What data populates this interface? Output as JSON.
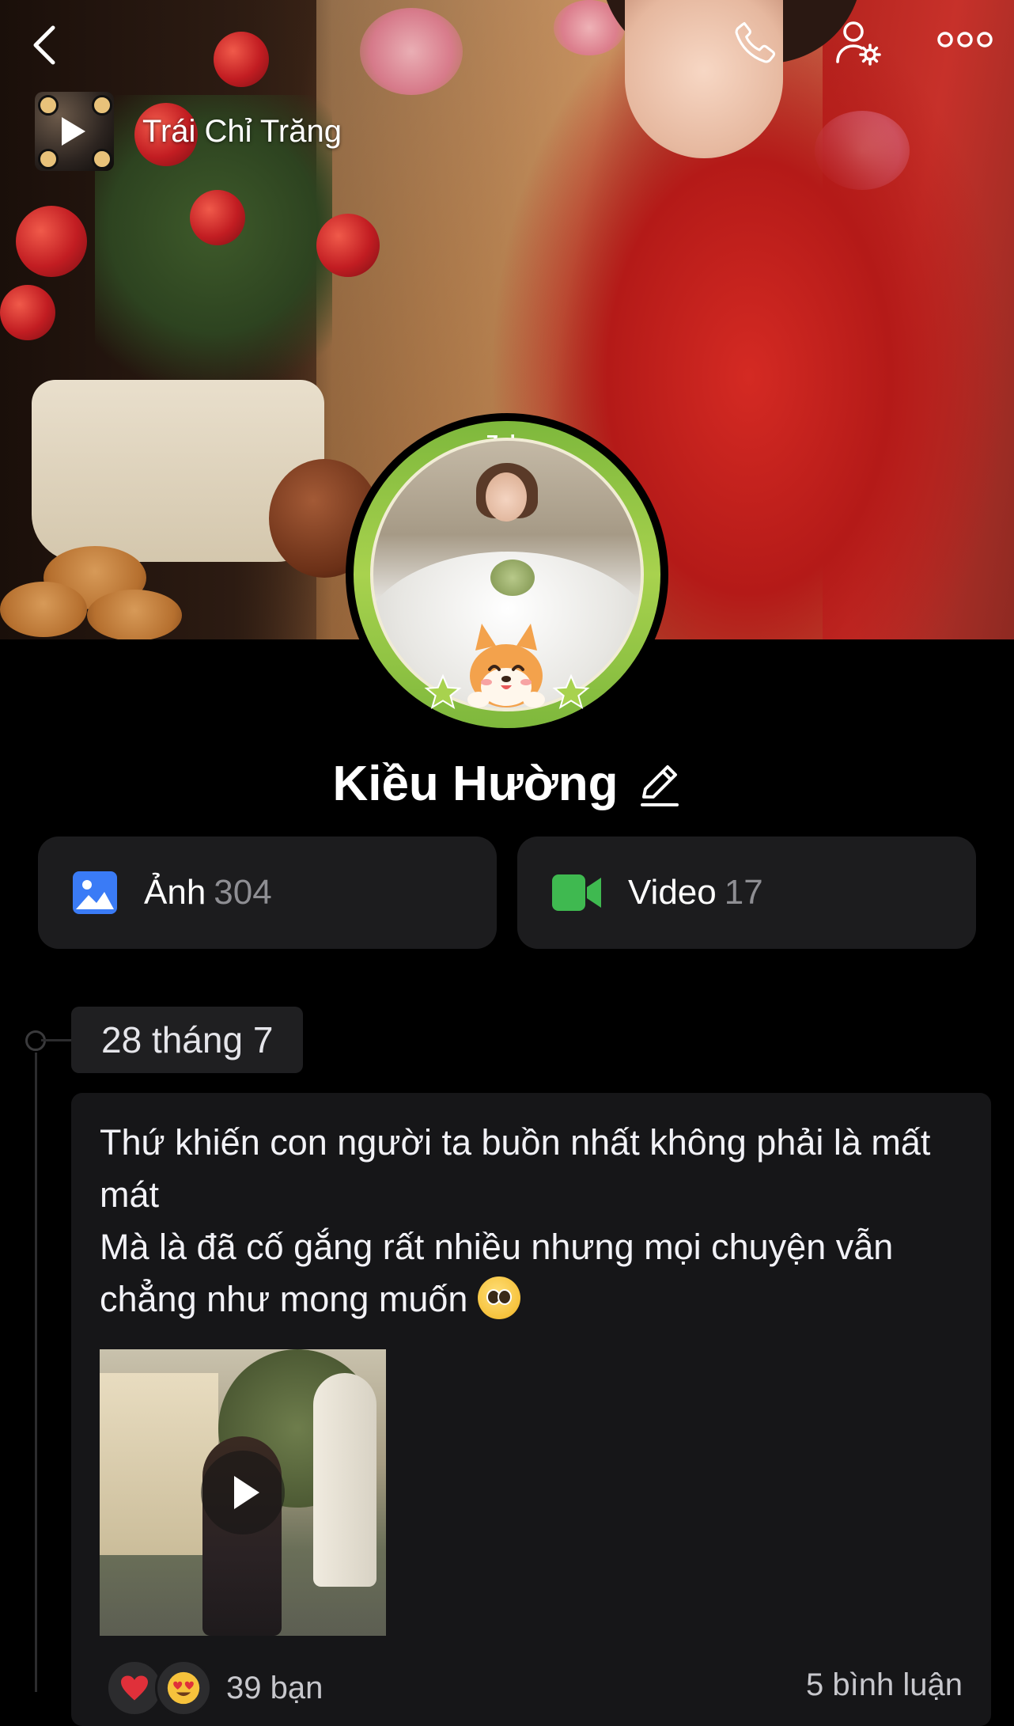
{
  "header": {
    "back_icon": "chevron-left-icon",
    "call_icon": "phone-icon",
    "settings_icon": "user-settings-icon",
    "more_icon": "more-horizontal-icon"
  },
  "music": {
    "title": "Trái Chỉ Trăng"
  },
  "avatar": {
    "frame_label": "Zalo"
  },
  "profile": {
    "name": "Kiều Hường"
  },
  "media": {
    "photos": {
      "label": "Ảnh",
      "count": "304",
      "icon": "photo-icon",
      "color": "#3a7bf6"
    },
    "videos": {
      "label": "Video",
      "count": "17",
      "icon": "video-camera-icon",
      "color": "#3fb950"
    }
  },
  "timeline": {
    "date": "28 tháng 7",
    "post": {
      "text": "Thứ khiến con người ta buồn nhất không phải là mất mát\nMà là đã cố gắng rất nhiều nhưng mọi chuyện vẫn chẳng như mong muốn",
      "emoji": "pleading-face",
      "media_type": "video",
      "reactions": {
        "icons": [
          "heart",
          "heart-eyes"
        ],
        "count_text": "39 bạn"
      },
      "comments_text": "5 bình luận"
    }
  },
  "colors": {
    "background": "#000000",
    "card": "#1c1c1e",
    "zalo_green": "#7eb83c"
  }
}
